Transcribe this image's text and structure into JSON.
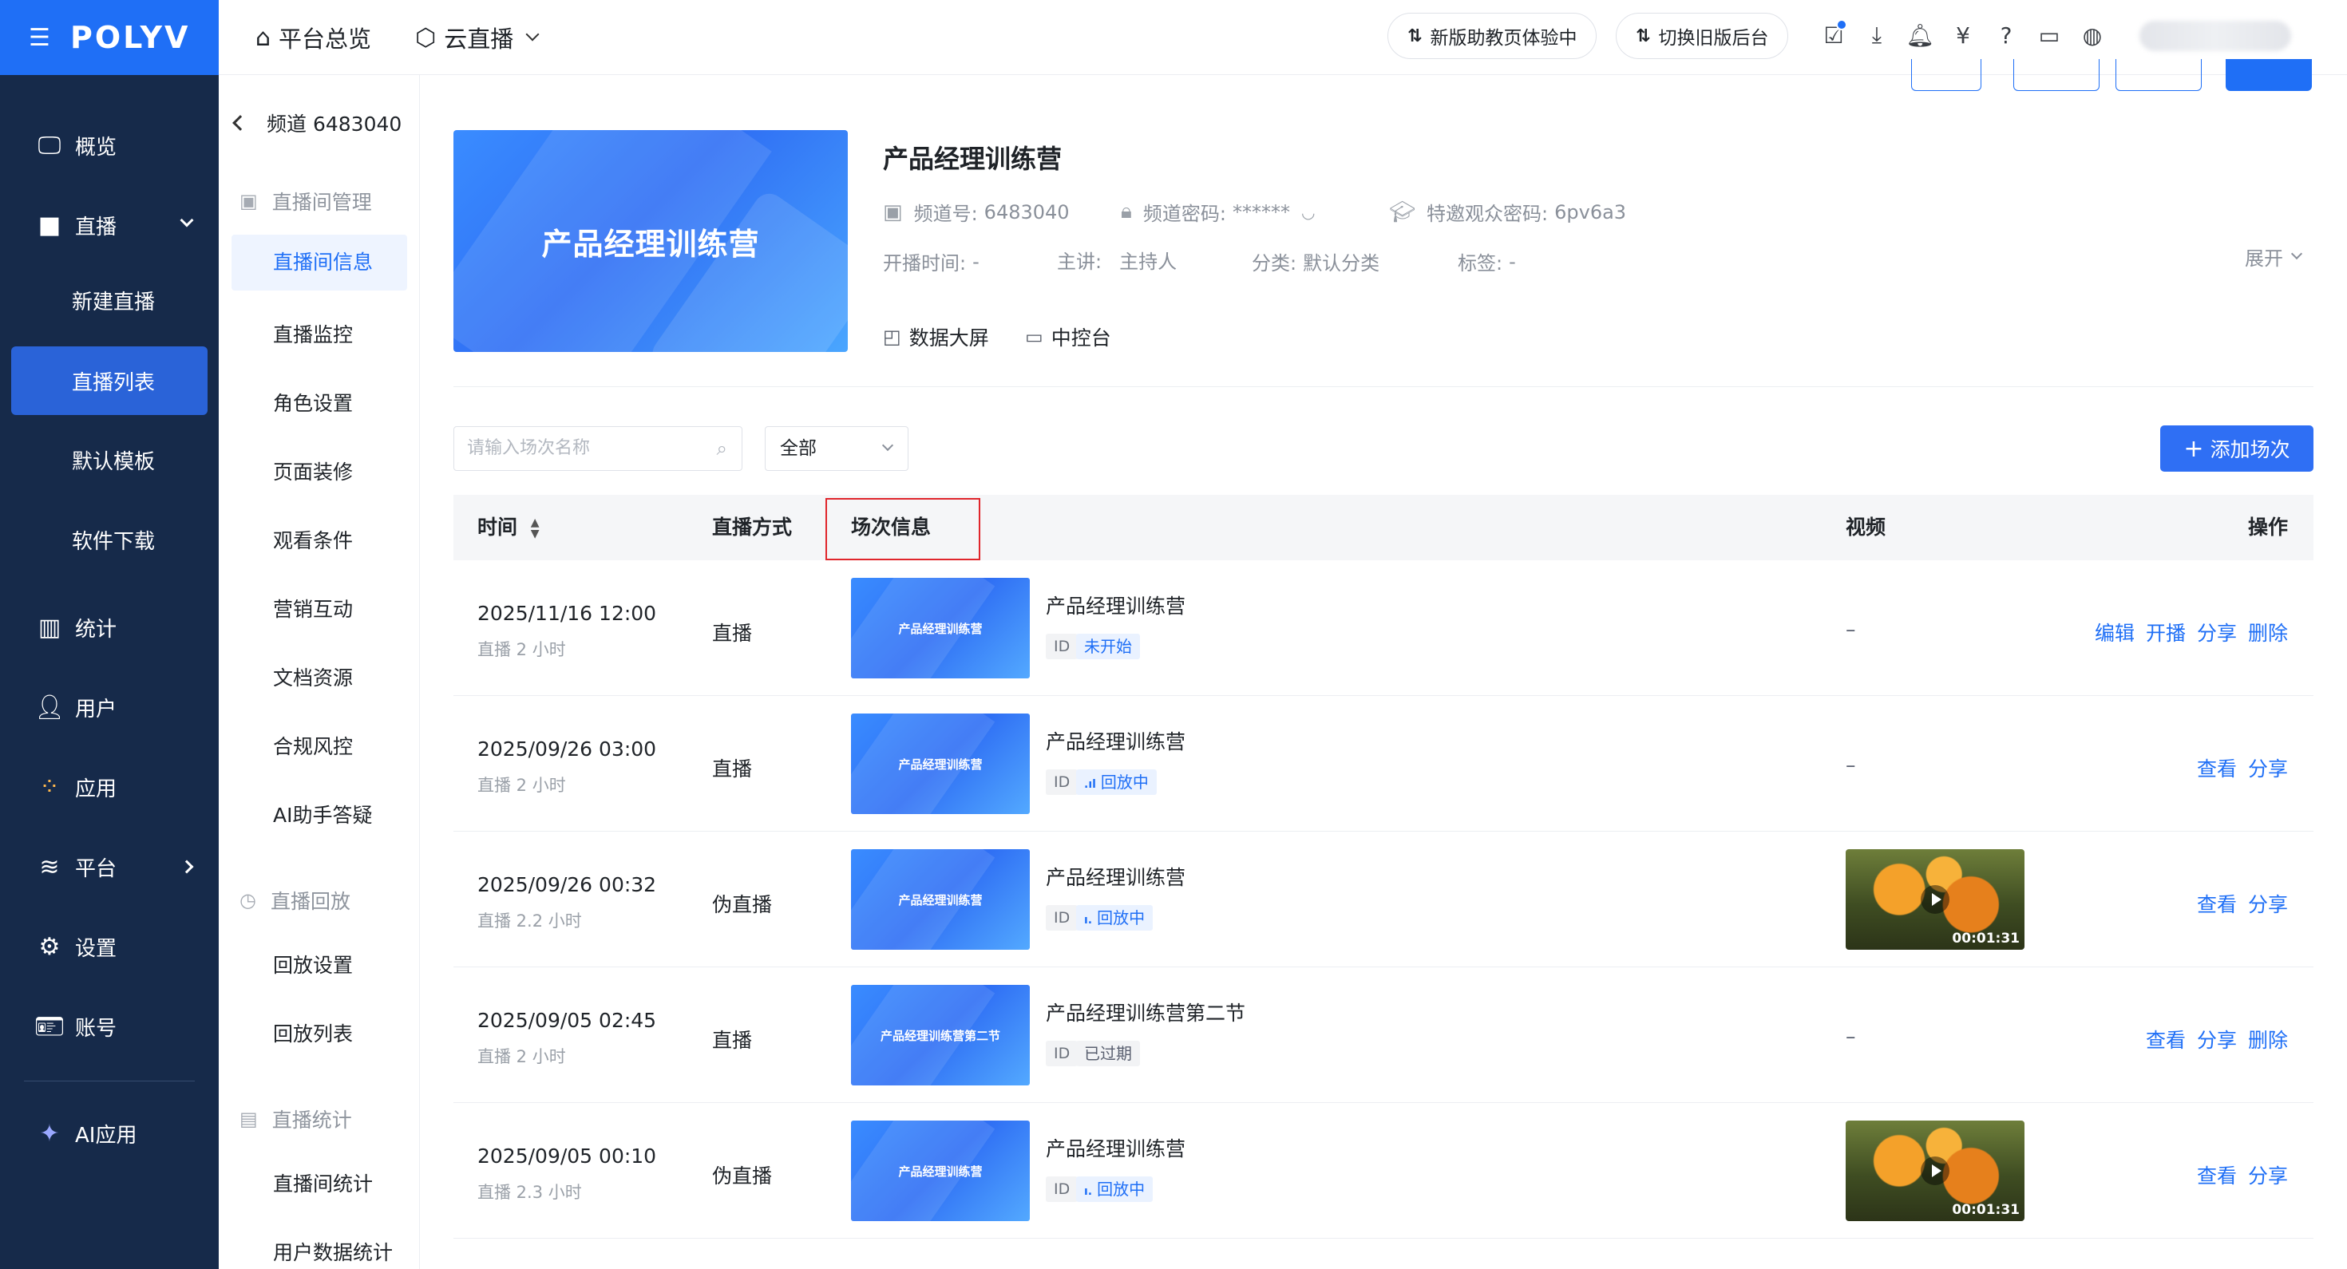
{
  "header": {
    "logo": "POLYV",
    "nav": [
      {
        "label": "平台总览"
      },
      {
        "label": "云直播"
      }
    ],
    "buttons": [
      {
        "label": "新版助教页体验中"
      },
      {
        "label": "切换旧版后台"
      }
    ]
  },
  "sidebar": {
    "items": [
      {
        "label": "概览"
      },
      {
        "label": "直播"
      },
      {
        "label": "新建直播"
      },
      {
        "label": "直播列表"
      },
      {
        "label": "默认模板"
      },
      {
        "label": "软件下载"
      },
      {
        "label": "统计"
      },
      {
        "label": "用户"
      },
      {
        "label": "应用"
      },
      {
        "label": "平台"
      },
      {
        "label": "设置"
      },
      {
        "label": "账号"
      },
      {
        "label": "AI应用"
      }
    ]
  },
  "subnav": {
    "channel": "频道 6483040",
    "groups": [
      {
        "label": "直播间管理"
      },
      {
        "label": "直播回放"
      },
      {
        "label": "直播统计"
      }
    ],
    "items": [
      {
        "label": "直播间信息"
      },
      {
        "label": "直播监控"
      },
      {
        "label": "角色设置"
      },
      {
        "label": "页面装修"
      },
      {
        "label": "观看条件"
      },
      {
        "label": "营销互动"
      },
      {
        "label": "文档资源"
      },
      {
        "label": "合规风控"
      },
      {
        "label": "AI助手答疑"
      },
      {
        "label": "回放设置"
      },
      {
        "label": "回放列表"
      },
      {
        "label": "直播间统计"
      },
      {
        "label": "用户数据统计"
      }
    ]
  },
  "channel": {
    "cover_text": "产品经理训练营",
    "title": "产品经理训练营",
    "channel_no_label": "频道号:",
    "channel_no": "6483040",
    "password_label": "频道密码:",
    "password": "******",
    "invite_label": "特邀观众密码:",
    "invite": "6pv6a3",
    "start_label": "开播时间:",
    "start": "-",
    "host_label": "主讲:",
    "host": "主持人",
    "category_label": "分类:",
    "category": "默认分类",
    "tag_label": "标签:",
    "tag": "-",
    "expand": "展开",
    "tools": [
      {
        "label": "数据大屏"
      },
      {
        "label": "中控台"
      }
    ]
  },
  "filter": {
    "search_placeholder": "请输入场次名称",
    "select_value": "全部",
    "add_button": "添加场次"
  },
  "table": {
    "headers": {
      "time": "时间",
      "mode": "直播方式",
      "session": "场次信息",
      "video": "视频",
      "ops": "操作"
    },
    "rows": [
      {
        "time": "2025/11/16 12:00",
        "duration": "直播 2 小时",
        "mode": "直播",
        "thumb": "产品经理训练营",
        "name": "产品经理训练营",
        "id": "ID",
        "status": "未开始",
        "status_style": "blue",
        "status_icon": "",
        "video": "–",
        "video_duration": "",
        "ops": [
          "编辑",
          "开播",
          "分享",
          "删除"
        ]
      },
      {
        "time": "2025/09/26 03:00",
        "duration": "直播 2 小时",
        "mode": "直播",
        "thumb": "产品经理训练营",
        "name": "产品经理训练营",
        "id": "ID",
        "status": "回放中",
        "status_style": "blue",
        "status_icon": ".ıl",
        "video": "–",
        "video_duration": "",
        "ops": [
          "查看",
          "分享"
        ]
      },
      {
        "time": "2025/09/26 00:32",
        "duration": "直播 2.2 小时",
        "mode": "伪直播",
        "thumb": "产品经理训练营",
        "name": "产品经理训练营",
        "id": "ID",
        "status": "回放中",
        "status_style": "blue",
        "status_icon": "ı.",
        "video": "",
        "video_duration": "00:01:31",
        "ops": [
          "查看",
          "分享"
        ]
      },
      {
        "time": "2025/09/05 02:45",
        "duration": "直播 2 小时",
        "mode": "直播",
        "thumb": "产品经理训练营第二节",
        "name": "产品经理训练营第二节",
        "id": "ID",
        "status": "已过期",
        "status_style": "gray",
        "status_icon": "",
        "video": "–",
        "video_duration": "",
        "ops": [
          "查看",
          "分享",
          "删除"
        ]
      },
      {
        "time": "2025/09/05 00:10",
        "duration": "直播 2.3 小时",
        "mode": "伪直播",
        "thumb": "产品经理训练营",
        "name": "产品经理训练营",
        "id": "ID",
        "status": "回放中",
        "status_style": "blue",
        "status_icon": "ı.",
        "video": "",
        "video_duration": "00:01:31",
        "ops": [
          "查看",
          "分享"
        ]
      }
    ]
  }
}
